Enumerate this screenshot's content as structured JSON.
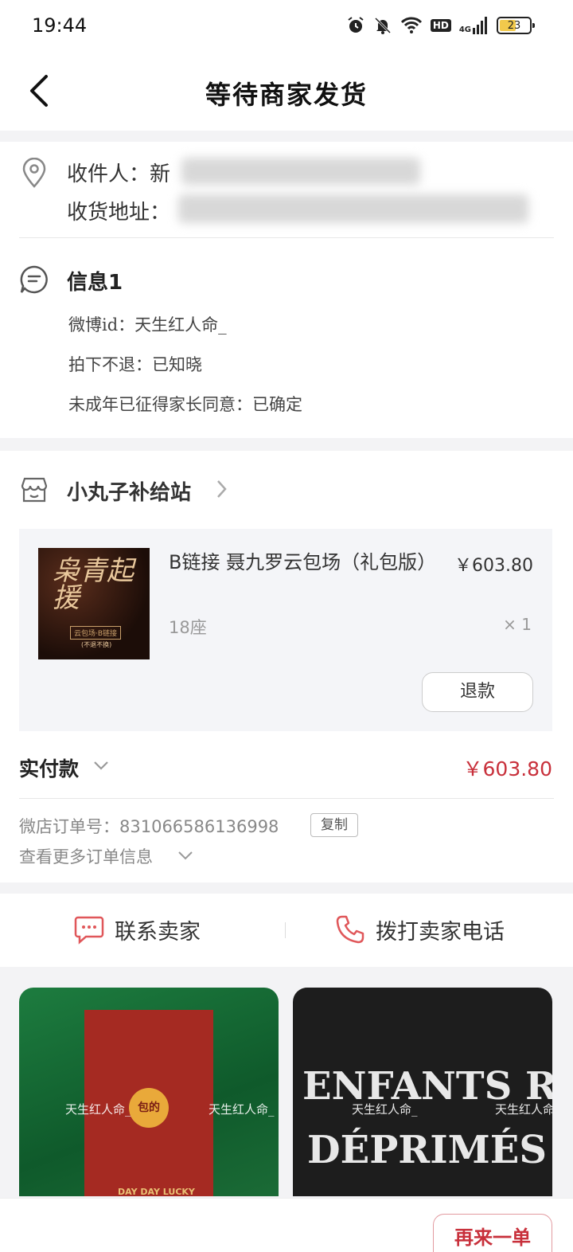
{
  "status_bar": {
    "time": "19:44",
    "hd": "HD",
    "network": "4G",
    "battery": "23"
  },
  "nav": {
    "title": "等待商家发货"
  },
  "address": {
    "receiver_label": "收件人：",
    "receiver_partial": "新",
    "address_label": "收货地址："
  },
  "info": {
    "title": "信息1",
    "lines": [
      "微博id：天生红人命_",
      "拍下不退：已知晓",
      "未成年已征得家长同意：已确定"
    ]
  },
  "shop": {
    "name": "小丸子补给站"
  },
  "item": {
    "thumb_title": "枭青起援",
    "thumb_tag": "云包场·B链接",
    "thumb_sub": "(不退不换)",
    "name": "B链接 聂九罗云包场（礼包版）",
    "price": "￥603.80",
    "spec": "18座",
    "qty": "× 1",
    "refund_label": "退款"
  },
  "payment": {
    "label": "实付款",
    "amount": "￥603.80"
  },
  "order": {
    "number_text": "微店订单号：831066586136998",
    "copy_label": "复制",
    "more_label": "查看更多订单信息"
  },
  "contact": {
    "chat_label": "联系卖家",
    "call_label": "拨打卖家电话"
  },
  "recommendations": {
    "left": {
      "seal_text": "包的",
      "footer_text": "DAY DAY LUCKY",
      "watermark": "天生红人命_"
    },
    "right": {
      "line1": "ENFANTS R",
      "line2": "DÉPRIMÉS",
      "watermark": "天生红人命_"
    }
  },
  "bottom": {
    "again_label": "再来一单"
  },
  "colors": {
    "accent_red": "#c8303b",
    "icon_red": "#e0575a"
  }
}
